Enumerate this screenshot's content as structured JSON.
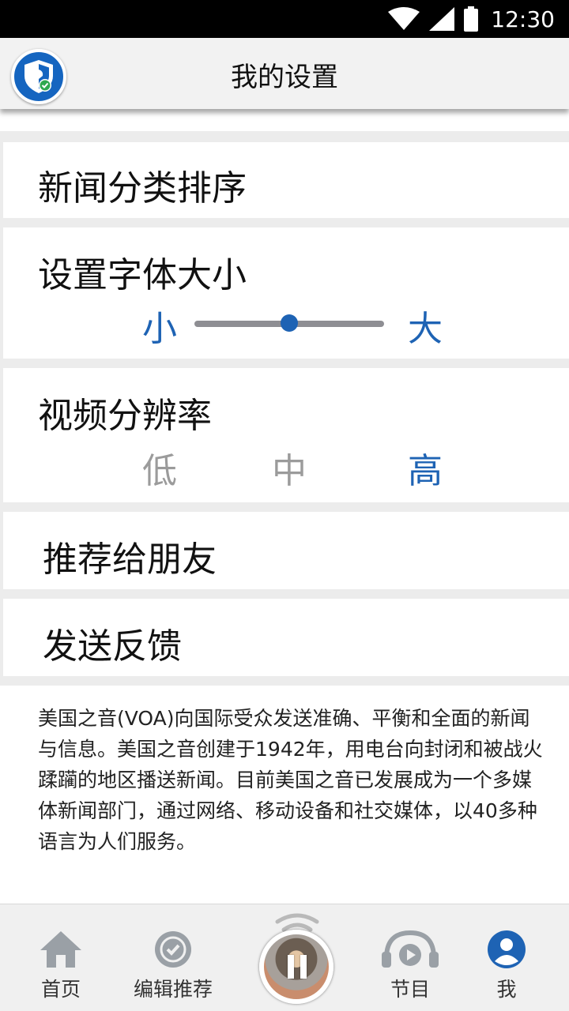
{
  "status_bar": {
    "time": "12:30",
    "icons": [
      "wifi-icon",
      "cell-signal-icon",
      "battery-icon"
    ]
  },
  "header": {
    "title": "我的设置",
    "logo_icon": "shield-check-icon"
  },
  "settings": {
    "news_sort_label": "新闻分类排序",
    "font_size": {
      "label": "设置字体大小",
      "small_label": "小",
      "large_label": "大",
      "level": 0.5
    },
    "video_resolution": {
      "label": "视频分辨率",
      "options": [
        "低",
        "中",
        "高"
      ],
      "selected": "高"
    },
    "recommend_label": "推荐给朋友",
    "feedback_label": "发送反馈"
  },
  "about": {
    "text": "美国之音(VOA)向国际受众发送准确、平衡和全面的新闻与信息。美国之音创建于1942年，用电台向封闭和被战火蹂躏的地区播送新闻。目前美国之音已发展成为一个多媒体新闻部门，通过网络、移动设备和社交媒体，以40多种语言为人们服务。"
  },
  "bottom_nav": {
    "items": [
      {
        "label": "首页",
        "icon": "home-icon"
      },
      {
        "label": "编辑推荐",
        "icon": "check-badge-icon"
      },
      {
        "label": "节目",
        "icon": "headphones-play-icon"
      },
      {
        "label": "我",
        "icon": "profile-icon"
      }
    ],
    "player_icon": "pause-icon"
  },
  "colors": {
    "accent": "#1e63b4",
    "inactive_option": "#9b9b9b",
    "nav_icon": "#9aa0a6"
  }
}
